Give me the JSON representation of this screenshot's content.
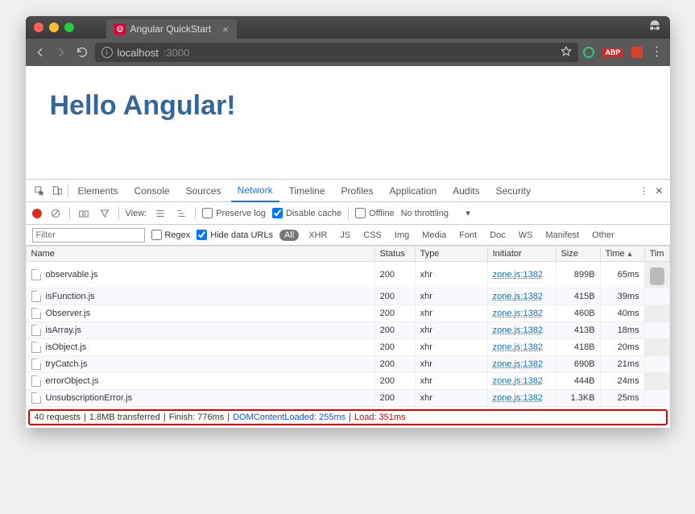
{
  "tab": {
    "title": "Angular QuickStart"
  },
  "url": {
    "host": "localhost",
    "port": ":3000"
  },
  "page": {
    "heading": "Hello Angular!"
  },
  "devtools": {
    "tabs": [
      "Elements",
      "Console",
      "Sources",
      "Network",
      "Timeline",
      "Profiles",
      "Application",
      "Audits",
      "Security"
    ],
    "activeTab": "Network",
    "toolbar": {
      "view_label": "View:",
      "preserve_log": "Preserve log",
      "disable_cache": "Disable cache",
      "offline": "Offline",
      "throttling": "No throttling"
    },
    "filter": {
      "placeholder": "Filter",
      "regex": "Regex",
      "hide_data_urls": "Hide data URLs",
      "types": [
        "All",
        "XHR",
        "JS",
        "CSS",
        "Img",
        "Media",
        "Font",
        "Doc",
        "WS",
        "Manifest",
        "Other"
      ]
    },
    "columns": {
      "name": "Name",
      "status": "Status",
      "type": "Type",
      "initiator": "Initiator",
      "size": "Size",
      "time": "Time",
      "timeline": "Tim"
    },
    "rows": [
      {
        "name": "observable.js",
        "status": "200",
        "type": "xhr",
        "initiator": "zone.js:1382",
        "size": "899B",
        "time": "65ms"
      },
      {
        "name": "isFunction.js",
        "status": "200",
        "type": "xhr",
        "initiator": "zone.js:1382",
        "size": "415B",
        "time": "39ms"
      },
      {
        "name": "Observer.js",
        "status": "200",
        "type": "xhr",
        "initiator": "zone.js:1382",
        "size": "460B",
        "time": "40ms"
      },
      {
        "name": "isArray.js",
        "status": "200",
        "type": "xhr",
        "initiator": "zone.js:1382",
        "size": "413B",
        "time": "18ms"
      },
      {
        "name": "isObject.js",
        "status": "200",
        "type": "xhr",
        "initiator": "zone.js:1382",
        "size": "418B",
        "time": "20ms"
      },
      {
        "name": "tryCatch.js",
        "status": "200",
        "type": "xhr",
        "initiator": "zone.js:1382",
        "size": "690B",
        "time": "21ms"
      },
      {
        "name": "errorObject.js",
        "status": "200",
        "type": "xhr",
        "initiator": "zone.js:1382",
        "size": "444B",
        "time": "24ms"
      },
      {
        "name": "UnsubscriptionError.js",
        "status": "200",
        "type": "xhr",
        "initiator": "zone.js:1382",
        "size": "1.3KB",
        "time": "25ms"
      }
    ],
    "summary": {
      "requests": "40 requests",
      "transferred": "1.8MB transferred",
      "finish": "Finish: 776ms",
      "dcl": "DOMContentLoaded: 255ms",
      "load": "Load: 351ms"
    }
  }
}
